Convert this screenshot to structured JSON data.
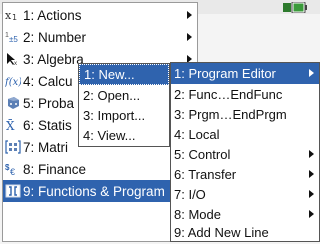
{
  "main_menu": {
    "items": [
      {
        "label": "1: Actions",
        "icon": "actions-icon",
        "has_submenu": true
      },
      {
        "label": "2: Number",
        "icon": "number-icon",
        "has_submenu": true
      },
      {
        "label": "3: Algebra",
        "icon": "algebra-icon",
        "has_submenu": true
      },
      {
        "label": "4: Calcu",
        "icon": "calculus-icon",
        "has_submenu": true
      },
      {
        "label": "5: Proba",
        "icon": "probability-icon",
        "has_submenu": true
      },
      {
        "label": "6: Statis",
        "icon": "statistics-icon",
        "has_submenu": true
      },
      {
        "label": "7: Matri",
        "icon": "matrix-icon",
        "has_submenu": true
      },
      {
        "label": "8: Finance",
        "icon": "finance-icon",
        "has_submenu": true
      },
      {
        "label": "9: Functions & Program",
        "icon": "functions-programs-icon",
        "has_submenu": true,
        "selected": true
      }
    ]
  },
  "functions_submenu": {
    "items": [
      {
        "label": "1: New...",
        "selected": true
      },
      {
        "label": "2: Open..."
      },
      {
        "label": "3: Import..."
      },
      {
        "label": "4: View..."
      }
    ]
  },
  "program_editor_submenu": {
    "items": [
      {
        "label": "1: Program Editor",
        "has_submenu": true,
        "selected": true
      },
      {
        "label": "2: Func…EndFunc"
      },
      {
        "label": "3: Prgm…EndPrgm"
      },
      {
        "label": "4: Local"
      },
      {
        "label": "5: Control",
        "has_submenu": true
      },
      {
        "label": "6: Transfer",
        "has_submenu": true
      },
      {
        "label": "7: I/O",
        "has_submenu": true
      },
      {
        "label": "8: Mode",
        "has_submenu": true
      },
      {
        "label": "9: Add New Line"
      }
    ]
  },
  "colors": {
    "selection": "#2f63ae",
    "menu_background": "#ffffff",
    "battery": "#3a9a3a"
  }
}
